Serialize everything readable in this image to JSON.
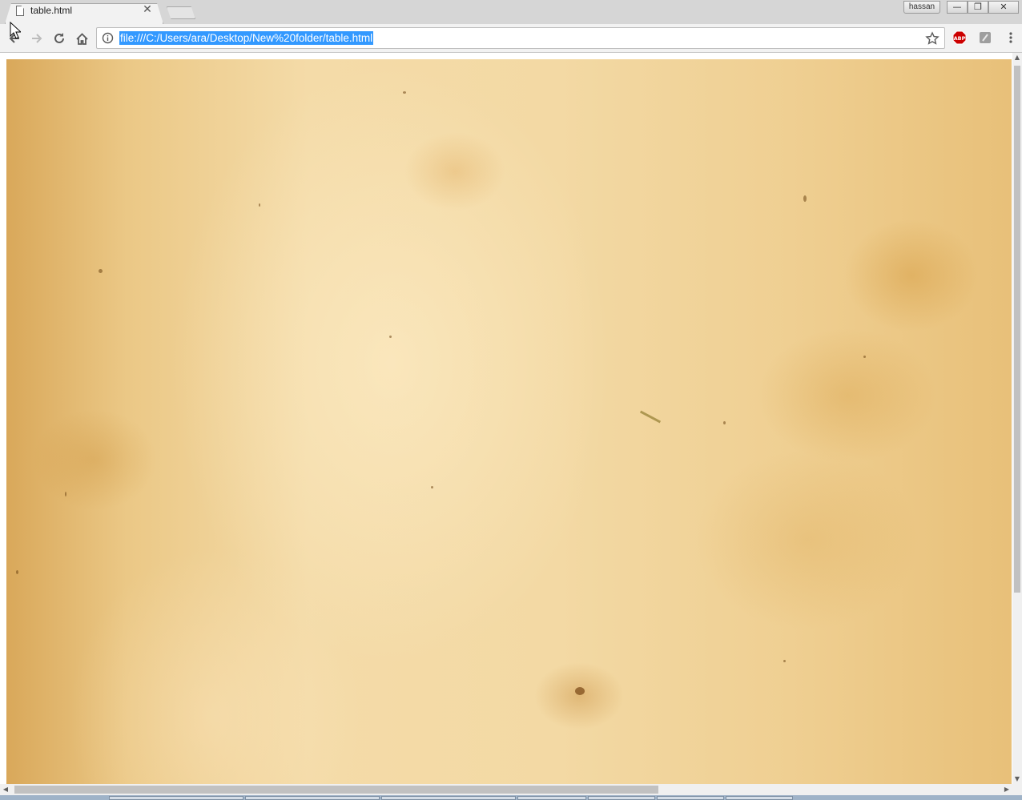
{
  "browser": {
    "tab": {
      "title": "table.html",
      "close_symbol": "✕"
    },
    "profile_name": "hassan",
    "window_controls": {
      "minimize": "—",
      "restore": "❐",
      "close": "✕"
    },
    "address_bar": {
      "url": "file:///C:/Users/ara/Desktop/New%20folder/table.html",
      "selected": true
    },
    "extensions": {
      "adblock_label": "ABP"
    }
  },
  "page": {
    "background": "aged parchment texture"
  },
  "scrollbars": {
    "vertical_arrow_up": "▲",
    "vertical_arrow_down": "▼",
    "horizontal_arrow_left": "◀",
    "horizontal_arrow_right": "▶"
  },
  "colors": {
    "selection": "#3399ff",
    "parchment_light": "#f4dba8",
    "parchment_dark": "#d9a85a",
    "adblock_red": "#cc0000"
  }
}
